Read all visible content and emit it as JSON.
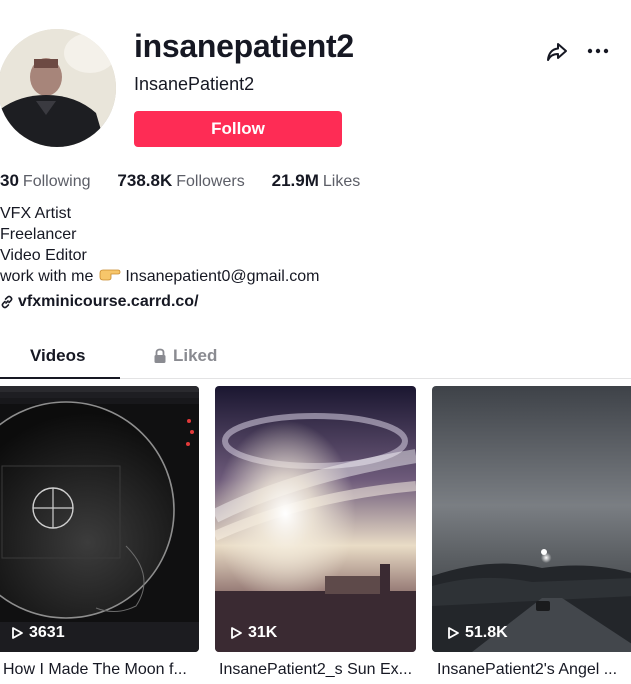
{
  "profile": {
    "username": "insanepatient2",
    "nickname": "InsanePatient2",
    "follow_label": "Follow"
  },
  "stats": {
    "following_count": "30",
    "following_label": "Following",
    "followers_count": "738.8K",
    "followers_label": "Followers",
    "likes_count": "21.9M",
    "likes_label": "Likes"
  },
  "bio": {
    "line1": "VFX Artist",
    "line2": "Freelancer",
    "line3": "Video Editor",
    "line4_prefix": "work with me",
    "line4_email": "Insanepatient0@gmail.com",
    "link": "vfxminicourse.carrd.co/"
  },
  "tabs": {
    "videos": "Videos",
    "liked": "Liked"
  },
  "videos": [
    {
      "views": "3631",
      "caption": "How I Made The Moon f..."
    },
    {
      "views": "31K",
      "caption": "InsanePatient2_s Sun Ex..."
    },
    {
      "views": "51.8K",
      "caption": "InsanePatient2's Angel ..."
    }
  ],
  "colors": {
    "follow_button": "#fe2c55",
    "text_primary": "#161823",
    "text_secondary": "#5c5e67"
  },
  "icons": {
    "share": "share-arrow-icon",
    "more": "more-dots-icon",
    "link": "link-icon",
    "lock": "lock-icon",
    "play": "play-icon",
    "hand": "pointing-hand-emoji"
  }
}
